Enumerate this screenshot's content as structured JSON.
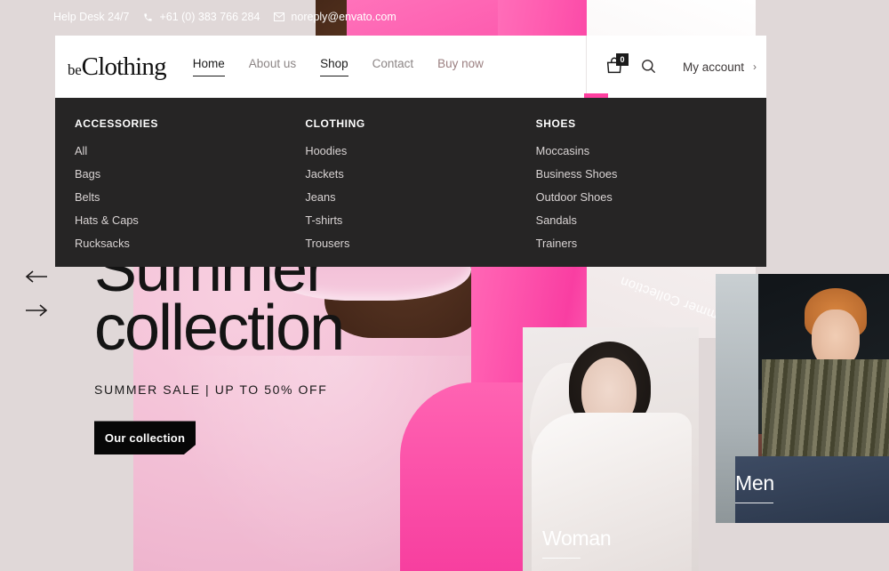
{
  "topbar": {
    "help": "Help Desk 24/7",
    "phone": "+61 (0) 383 766 284",
    "email": "noreply@envato.com"
  },
  "header": {
    "logo_small": "be",
    "logo_main": "Clothing",
    "nav": [
      {
        "label": "Home",
        "state": "underlined"
      },
      {
        "label": "About us",
        "state": "default"
      },
      {
        "label": "Shop",
        "state": "active"
      },
      {
        "label": "Contact",
        "state": "default"
      },
      {
        "label": "Buy now",
        "state": "accent"
      }
    ],
    "cart_count": "0",
    "account_label": "My account",
    "account_chevron": "›",
    "accent_color": "#ff3fa0"
  },
  "mega_menu": {
    "columns": [
      {
        "title": "ACCESSORIES",
        "links": [
          "All",
          "Bags",
          "Belts",
          "Hats & Caps",
          "Rucksacks"
        ]
      },
      {
        "title": "CLOTHING",
        "links": [
          "Hoodies",
          "Jackets",
          "Jeans",
          "T-shirts",
          "Trousers"
        ]
      },
      {
        "title": "SHOES",
        "links": [
          "Moccasins",
          "Business Shoes",
          "Outdoor Shoes",
          "Sandals",
          "Trainers"
        ]
      }
    ]
  },
  "hero": {
    "title_line1": "Summer",
    "title_line2": "collection",
    "subtitle": "SUMMER SALE | UP TO 50% OFF",
    "cta": "Our collection",
    "rotated_badge": "Summer Collection",
    "prev_arrow": "←",
    "next_arrow": "→"
  },
  "cards": [
    {
      "label": "Woman"
    },
    {
      "label": "Men"
    }
  ]
}
